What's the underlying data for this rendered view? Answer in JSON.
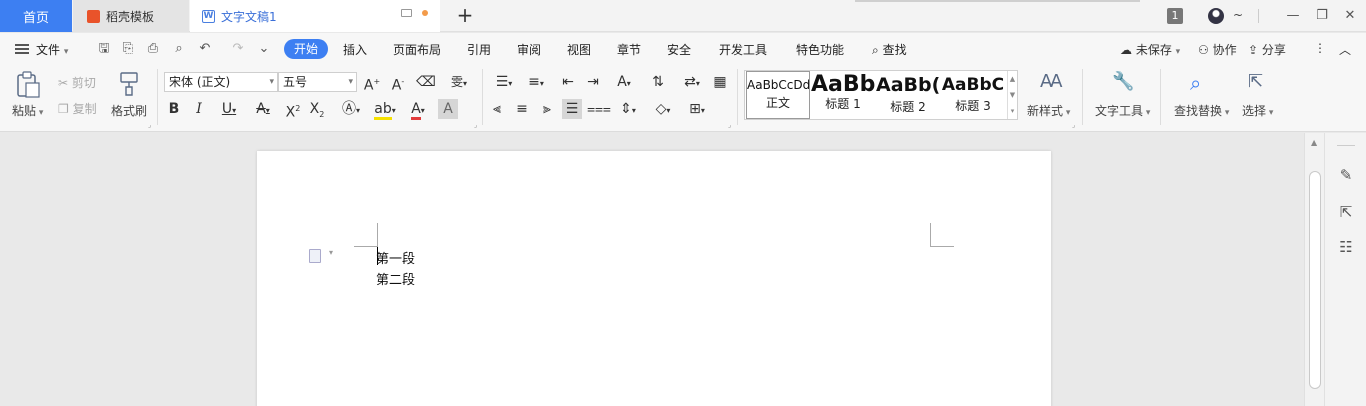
{
  "tabs": {
    "home": "首页",
    "daoke": "稻壳模板",
    "doc": "文字文稿1",
    "new_tab": "+"
  },
  "window": {
    "badge": "1",
    "tilde": "~",
    "minimize": "—",
    "restore": "❐",
    "close": "✕"
  },
  "menu": {
    "file": "文件",
    "items": [
      "开始",
      "插入",
      "页面布局",
      "引用",
      "审阅",
      "视图",
      "章节",
      "安全",
      "开发工具",
      "特色功能"
    ],
    "search": "查找",
    "unsaved": "未保存",
    "collab": "协作",
    "share": "分享"
  },
  "ribbon": {
    "paste": "粘贴",
    "cut": "剪切",
    "copy": "复制",
    "format_painter": "格式刷",
    "font_name": "宋体 (正文)",
    "font_size": "五号",
    "styles": [
      {
        "sample": "AaBbCcDd",
        "name": "正文"
      },
      {
        "sample": "AaBb",
        "name": "标题 1"
      },
      {
        "sample": "AaBb(",
        "name": "标题 2"
      },
      {
        "sample": "AaBbC",
        "name": "标题 3"
      }
    ],
    "new_style": "新样式",
    "text_tools": "文字工具",
    "find_replace": "查找替换",
    "select": "选择"
  },
  "document": {
    "paragraphs": [
      "第一段",
      "第二段"
    ]
  },
  "colors": {
    "accent": "#3d7ff2",
    "tab_active_text": "#3a6fd8",
    "daoke_icon": "#e9532a",
    "highlight": "#f5e100",
    "font_color": "#e23b3b"
  }
}
